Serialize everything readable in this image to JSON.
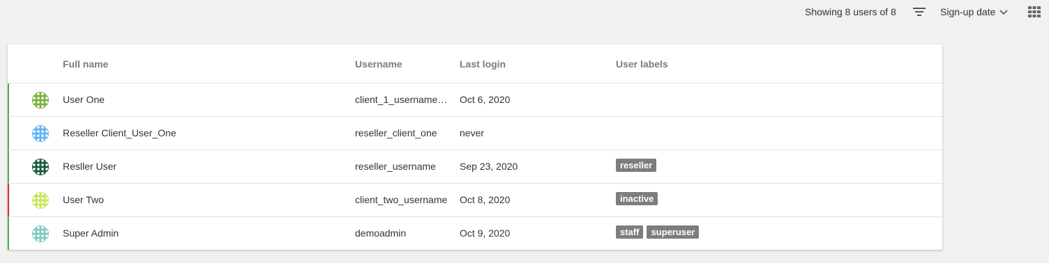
{
  "toolbar": {
    "count_text": "Showing 8 users of 8",
    "filter_icon": "filter-icon",
    "sort_label": "Sign-up date",
    "sort_icon": "chevron-down-icon",
    "view_icon": "grid-view-icon"
  },
  "table": {
    "headers": {
      "full_name": "Full name",
      "username": "Username",
      "last_login": "Last login",
      "user_labels": "User labels"
    },
    "rows": [
      {
        "full_name": "User One",
        "username": "client_1_username@fl...",
        "last_login": "Oct 6, 2020",
        "labels": [],
        "status_color": "#4caf50",
        "avatar_color": "#7cb342"
      },
      {
        "full_name": "Reseller Client_User_One",
        "username": "reseller_client_one",
        "last_login": "never",
        "labels": [],
        "status_color": "#4caf50",
        "avatar_color": "#64b5f6"
      },
      {
        "full_name": "Resller User",
        "username": "reseller_username",
        "last_login": "Sep 23, 2020",
        "labels": [
          "reseller"
        ],
        "status_color": "#4caf50",
        "avatar_color": "#1b5e3b"
      },
      {
        "full_name": "User Two",
        "username": "client_two_username",
        "last_login": "Oct 8, 2020",
        "labels": [
          "inactive"
        ],
        "status_color": "#d32f2f",
        "avatar_color": "#c6e85a"
      },
      {
        "full_name": "Super Admin",
        "username": "demoadmin",
        "last_login": "Oct 9, 2020",
        "labels": [
          "staff",
          "superuser"
        ],
        "status_color": "#4caf50",
        "avatar_color": "#80cbc4"
      }
    ]
  }
}
